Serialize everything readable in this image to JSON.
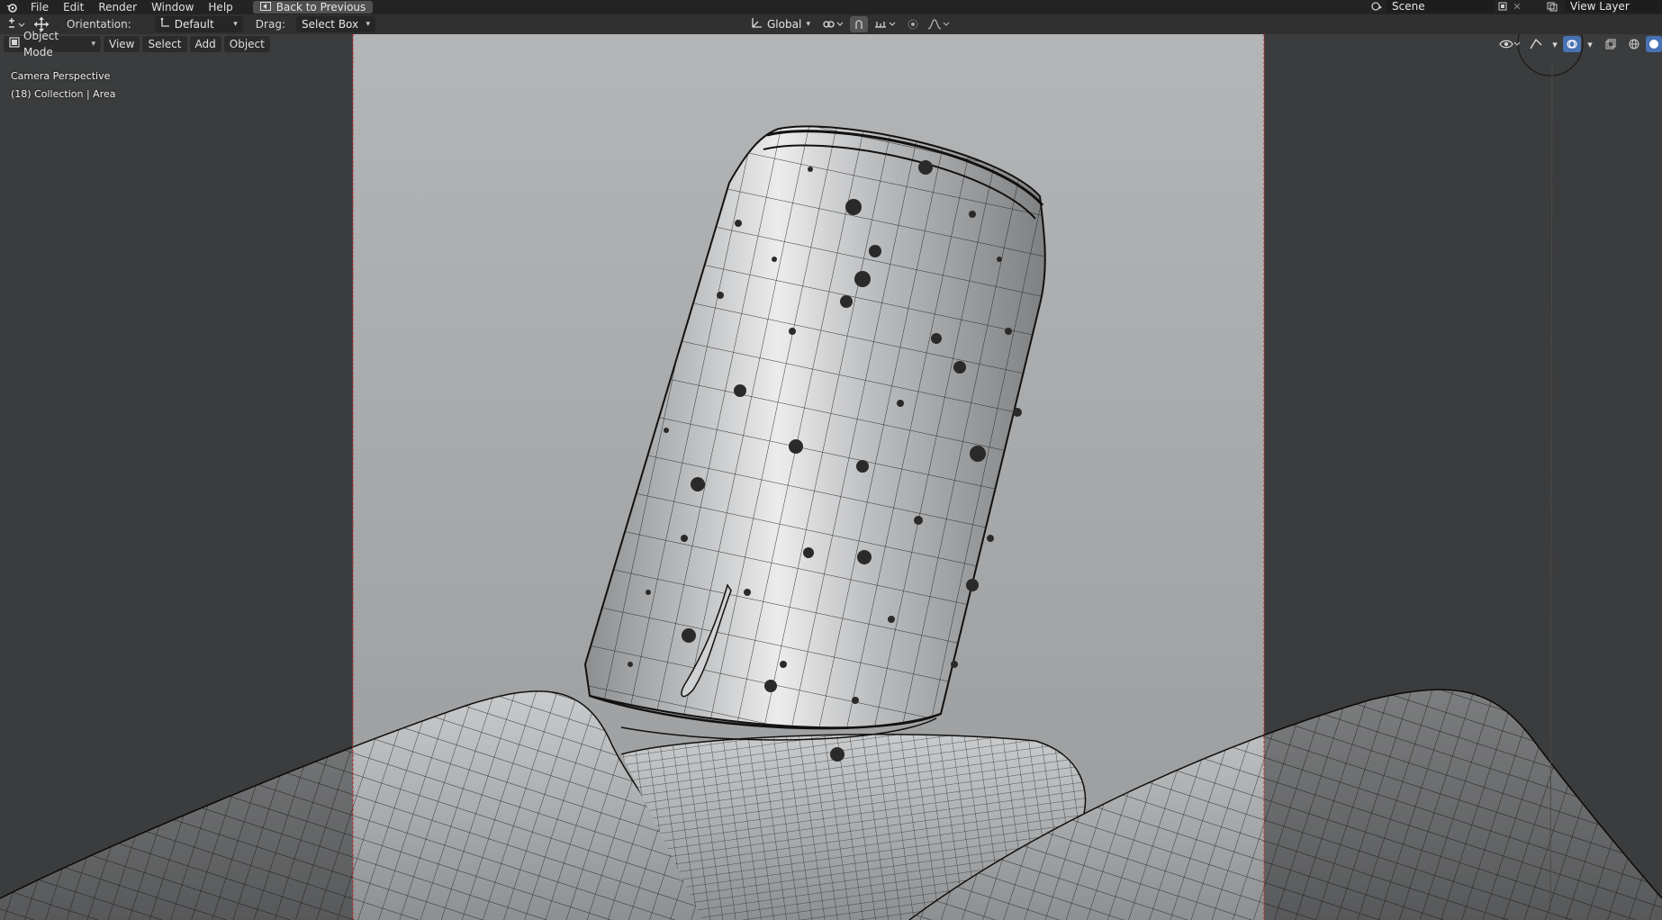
{
  "menubar": {
    "items": [
      "File",
      "Edit",
      "Render",
      "Window",
      "Help"
    ],
    "back_button": "Back to Previous",
    "scene_name": "Scene",
    "view_layer": "View Layer"
  },
  "toolheader": {
    "orientation_label": "Orientation:",
    "orientation_value": "Default",
    "drag_label": "Drag:",
    "drag_value": "Select Box",
    "transform_orientation": "Global"
  },
  "viewport_header": {
    "mode": "Object Mode",
    "menus": [
      "View",
      "Select",
      "Add",
      "Object"
    ]
  },
  "viewport_overlay": {
    "line1": "Camera Perspective",
    "line2": "(18) Collection | Area"
  },
  "colors": {
    "menubar_bg": "#232323",
    "header_bg": "#303030",
    "viewport_bg": "#5d5f61",
    "camera_frame_bg": "#a9acae",
    "camera_border": "#d12a2a",
    "accent_blue": "#4772b3"
  },
  "icons": [
    "blender-logo-icon",
    "back-icon",
    "scene-icon",
    "view-layer-icon",
    "transform-icon",
    "move-icon",
    "orientation-icon",
    "global-icon",
    "pivot-icon",
    "snap-icon",
    "proportional-icon",
    "visibility-icon",
    "gizmo-icon",
    "overlay-icon",
    "xray-icon",
    "wireframe-shading-icon",
    "solid-shading-icon"
  ]
}
